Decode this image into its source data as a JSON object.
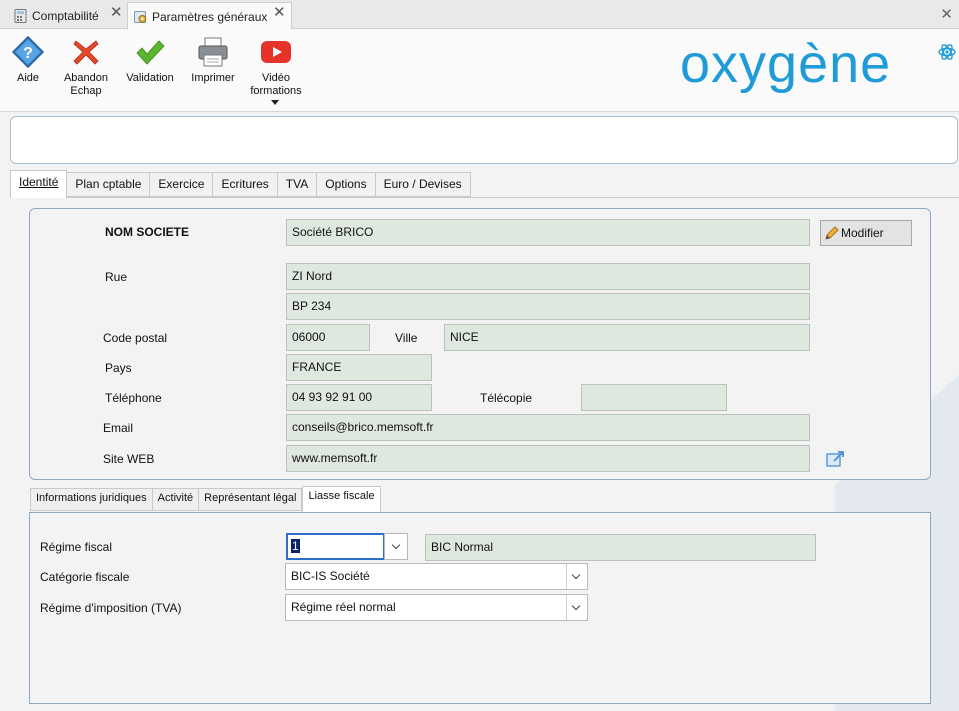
{
  "doc_tabs": [
    {
      "label": "Comptabilité",
      "icon": "calculator-icon"
    },
    {
      "label": "Paramètres généraux",
      "icon": "settings-gear-icon"
    }
  ],
  "toolbar": {
    "aide": "Aide",
    "abandon_1": "Abandon",
    "abandon_2": "Echap",
    "validation": "Validation",
    "imprimer": "Imprimer",
    "video_1": "Vidéo",
    "video_2": "formations"
  },
  "logo": {
    "text": "oxygène",
    "color": "#1f9bd8"
  },
  "main_tabs": [
    "Identité",
    "Plan cptable",
    "Exercice",
    "Ecritures",
    "TVA",
    "Options",
    "Euro / Devises"
  ],
  "identity": {
    "nom_label": "NOM SOCIETE",
    "nom_value": "Société BRICO",
    "modifier": "Modifier",
    "rue_label": "Rue",
    "rue1": "ZI Nord",
    "rue2": "BP 234",
    "cp_label": "Code postal",
    "cp_value": "06000",
    "ville_label": "Ville",
    "ville_value": "NICE",
    "pays_label": "Pays",
    "pays_value": "FRANCE",
    "tel_label": "Téléphone",
    "tel_value": "04 93 92 91 00",
    "fax_label": "Télécopie",
    "fax_value": "",
    "email_label": "Email",
    "email_value": "conseils@brico.memsoft.fr",
    "web_label": "Site WEB",
    "web_value": "www.memsoft.fr"
  },
  "sub_tabs": [
    "Informations juridiques",
    "Activité",
    "Représentant légal",
    "Liasse fiscale"
  ],
  "liasse": {
    "regime_label": "Régime fiscal",
    "regime_code": "1",
    "regime_value": "BIC Normal",
    "categorie_label": "Catégorie fiscale",
    "categorie_value": "BIC-IS Société",
    "tva_label": "Régime d'imposition (TVA)",
    "tva_value": "Régime réel normal"
  }
}
